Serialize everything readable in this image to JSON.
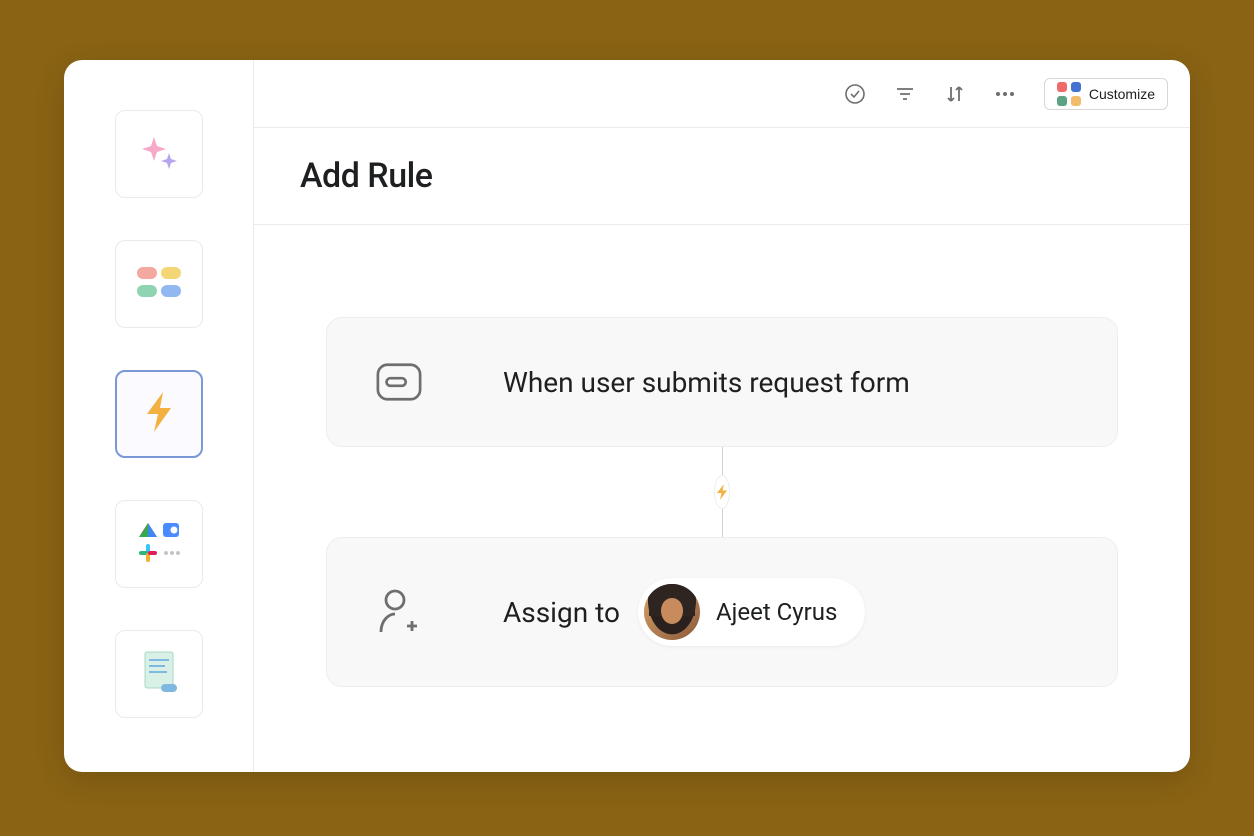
{
  "page": {
    "title": "Add Rule"
  },
  "toolbar": {
    "customize_label": "Customize"
  },
  "rule": {
    "trigger_text": "When user submits request form",
    "action_label": "Assign to",
    "assignee_name": "Ajeet Cyrus"
  },
  "sidebar": {
    "items": [
      {
        "name": "ai-sparkle"
      },
      {
        "name": "apps-grid"
      },
      {
        "name": "automation",
        "active": true
      },
      {
        "name": "integrations"
      },
      {
        "name": "document"
      }
    ]
  },
  "colors": {
    "accent_yellow": "#f2b140",
    "border_active": "#7a97d6",
    "background": "#8a6314"
  }
}
